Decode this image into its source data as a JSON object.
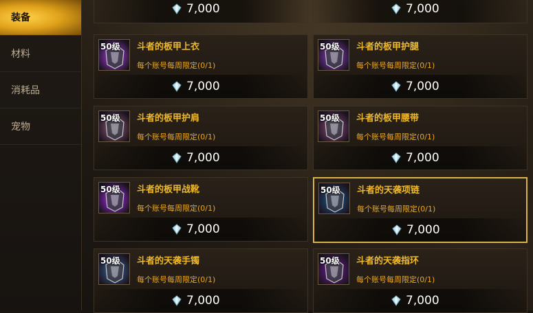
{
  "sidebar": {
    "tabs": [
      {
        "label": "装备",
        "active": true
      },
      {
        "label": "材料",
        "active": false
      },
      {
        "label": "消耗品",
        "active": false
      },
      {
        "label": "宠物",
        "active": false
      }
    ]
  },
  "currency_icon": "crystal-gem-icon",
  "top_row_prices": [
    "7,000",
    "7,000"
  ],
  "items": [
    {
      "level": "50级",
      "name": "斗者的板甲上衣",
      "limit_text": "每个账号每周限定(",
      "limit_count": "0/1",
      "limit_close": ")",
      "price": "7,000",
      "selected": false
    },
    {
      "level": "50级",
      "name": "斗者的板甲护腿",
      "limit_text": "每个账号每周限定(",
      "limit_count": "0/1",
      "limit_close": ")",
      "price": "7,000",
      "selected": false
    },
    {
      "level": "50级",
      "name": "斗者的板甲护肩",
      "limit_text": "每个账号每周限定(",
      "limit_count": "0/1",
      "limit_close": ")",
      "price": "7,000",
      "selected": false
    },
    {
      "level": "50级",
      "name": "斗者的板甲腰带",
      "limit_text": "每个账号每周限定(",
      "limit_count": "0/1",
      "limit_close": ")",
      "price": "7,000",
      "selected": false
    },
    {
      "level": "50级",
      "name": "斗者的板甲战靴",
      "limit_text": "每个账号每周限定(",
      "limit_count": "0/1",
      "limit_close": ")",
      "price": "7,000",
      "selected": false
    },
    {
      "level": "50级",
      "name": "斗者的天袭项链",
      "limit_text": "每个账号每周限定(",
      "limit_count": "0/1",
      "limit_close": ")",
      "price": "7,000",
      "selected": true
    },
    {
      "level": "50级",
      "name": "斗者的天袭手镯",
      "limit_text": "每个账号每周限定(",
      "limit_count": "0/1",
      "limit_close": ")",
      "price": "7,000",
      "selected": false
    },
    {
      "level": "50级",
      "name": "斗者的天袭指环",
      "limit_text": "每个账号每周限定(",
      "limit_count": "0/1",
      "limit_close": ")",
      "price": "7,000",
      "selected": false
    }
  ]
}
